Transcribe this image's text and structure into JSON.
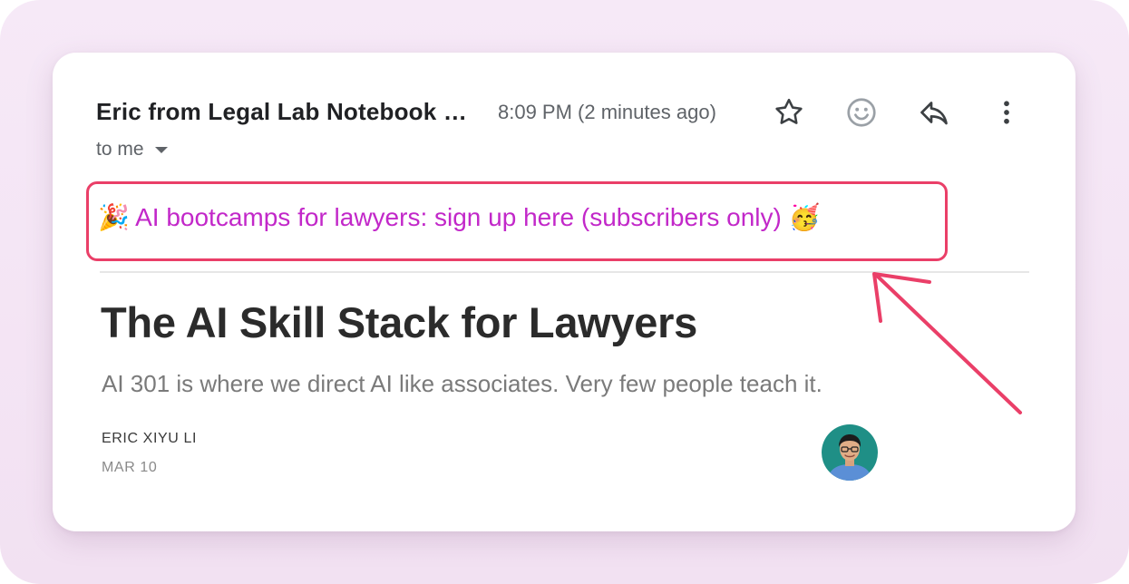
{
  "email": {
    "sender": "Eric from Legal Lab Notebook …",
    "time": "8:09 PM (2 minutes ago)",
    "recipient": "to me"
  },
  "toolbar": {
    "star_icon": "star-icon",
    "emoji_icon": "emoji-reaction-icon",
    "reply_icon": "reply-icon",
    "more_icon": "more-vert-icon"
  },
  "banner": {
    "text": "🎉 AI bootcamps for lawyers: sign up here (subscribers only) 🥳",
    "text_color": "#c228c9",
    "border_color": "#ea3f68"
  },
  "post": {
    "title": "The AI Skill Stack for Lawyers",
    "subtitle": "AI 301 is where we direct AI like associates. Very few people teach it.",
    "author": "ERIC XIYU LI",
    "date": "MAR 10"
  },
  "annotation": {
    "arrow_color": "#ea3f68"
  }
}
